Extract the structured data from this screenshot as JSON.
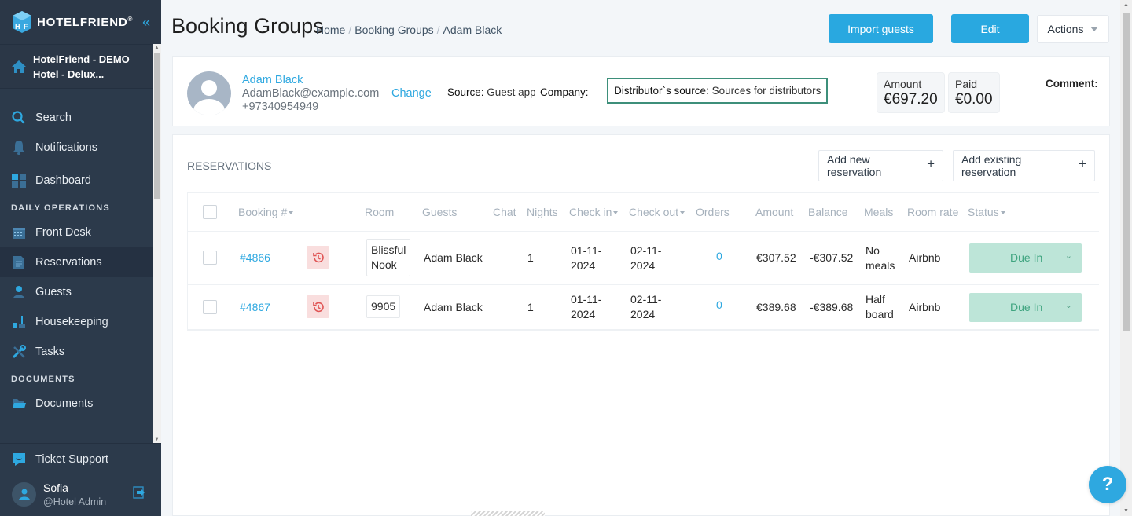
{
  "brand": {
    "name": "HOTELFRIEND",
    "reg": "®"
  },
  "sidebar": {
    "hotel_name": "HotelFriend - DEMO Hotel - Delux...",
    "hotel_line1": "HotelFriend - DEMO",
    "hotel_line2": "Hotel - Delux...",
    "top_items": [
      {
        "label": "Search",
        "icon": "search-icon"
      },
      {
        "label": "Notifications",
        "icon": "bell-icon"
      },
      {
        "label": "Dashboard",
        "icon": "dashboard-icon"
      }
    ],
    "section_daily": "DAILY OPERATIONS",
    "daily_items": [
      {
        "label": "Front Desk",
        "icon": "calendar-icon"
      },
      {
        "label": "Reservations",
        "icon": "document-icon",
        "active": true
      },
      {
        "label": "Guests",
        "icon": "person-icon"
      },
      {
        "label": "Housekeeping",
        "icon": "broom-icon"
      },
      {
        "label": "Tasks",
        "icon": "tools-icon"
      }
    ],
    "section_documents": "DOCUMENTS",
    "document_items": [
      {
        "label": "Documents",
        "icon": "folder-icon"
      }
    ],
    "ticket_support": "Ticket Support",
    "user": {
      "name": "Sofia",
      "role": "@Hotel Admin"
    }
  },
  "header": {
    "title": "Booking Groups",
    "breadcrumb": [
      "Home",
      "Booking Groups",
      "Adam Black"
    ],
    "import_label": "Import guests",
    "edit_label": "Edit",
    "actions_label": "Actions"
  },
  "guest": {
    "name": "Adam Black",
    "email": "AdamBlack@example.com",
    "phone": "+97340954949",
    "change_label": "Change",
    "source_label": "Source:",
    "source_value": "Guest app",
    "company_label": "Company:",
    "company_value": "—",
    "distributor_label": "Distributor`s source:",
    "distributor_value": "Sources for distributors",
    "amount_label": "Amount",
    "amount_value": "€697.20",
    "paid_label": "Paid",
    "paid_value": "€0.00",
    "comment_label": "Comment:",
    "comment_value": "–"
  },
  "reservations": {
    "title": "RESERVATIONS",
    "add_new_label": "Add new reservation",
    "add_existing_label": "Add existing reservation",
    "columns": [
      "Booking #",
      "Room",
      "Guests",
      "Chat",
      "Nights",
      "Check in",
      "Check out",
      "Orders",
      "Amount",
      "Balance",
      "Meals",
      "Room rate",
      "Status"
    ],
    "rows": [
      {
        "booking": "#4866",
        "room": "Blissful Nook",
        "guests": "Adam Black",
        "nights": "1",
        "check_in": "01-11-2024",
        "check_in_a": "01-11-",
        "check_in_b": "2024",
        "check_out": "02-11-2024",
        "check_out_a": "02-11-",
        "check_out_b": "2024",
        "orders": "0",
        "amount": "€307.52",
        "balance": "-€307.52",
        "meals": "No meals",
        "room_rate": "Airbnb",
        "status": "Due In"
      },
      {
        "booking": "#4867",
        "room": "9905",
        "guests": "Adam Black",
        "nights": "1",
        "check_in": "01-11-2024",
        "check_in_a": "01-11-",
        "check_in_b": "2024",
        "check_out": "02-11-2024",
        "check_out_a": "02-11-",
        "check_out_b": "2024",
        "orders": "0",
        "amount": "€389.68",
        "balance": "-€389.68",
        "meals": "Half board",
        "room_rate": "Airbnb",
        "status": "Due In"
      }
    ]
  },
  "help_label": "?",
  "colors": {
    "accent": "#29a8e0",
    "sidebar_bg": "#2c3a4b",
    "status_bg": "#bde5d8",
    "status_text": "#3ea47f",
    "distributor_border": "#3d8f7a",
    "history_bg": "#f9dede"
  }
}
